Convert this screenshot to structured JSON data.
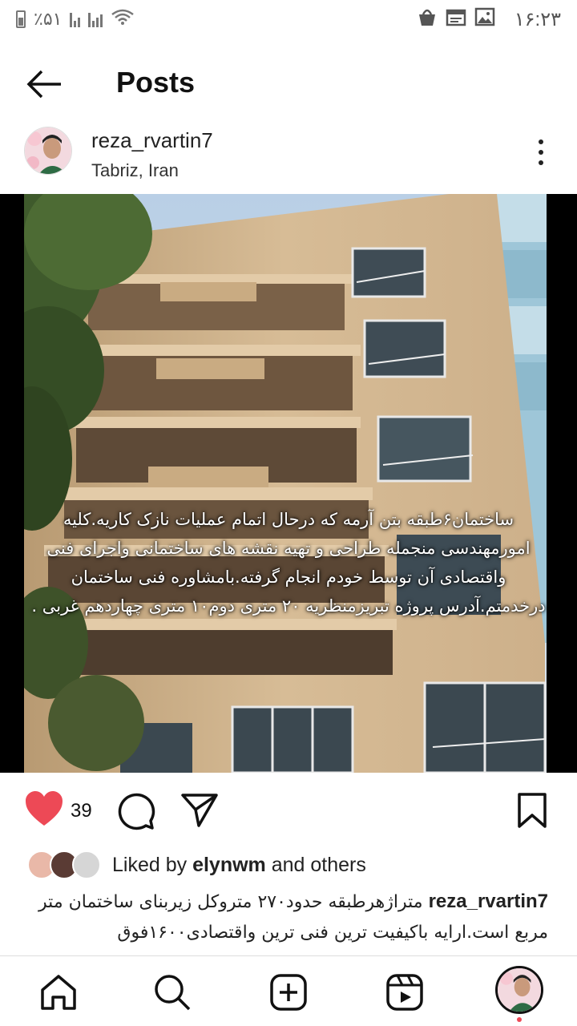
{
  "status_bar": {
    "battery": "٪۵۱",
    "time": "۱۶:۲۳",
    "icons": [
      "battery-icon",
      "signal-icon",
      "signal-icon",
      "wifi-icon",
      "shop-bag-icon",
      "calendar-icon",
      "gallery-icon"
    ]
  },
  "header": {
    "title": "Posts",
    "back_icon": "arrow-left-icon"
  },
  "post": {
    "username": "reza_rvartin7",
    "location": "Tabriz, Iran",
    "more_icon": "more-vertical-icon",
    "image_overlay_lines": [
      "ساختمان۶طبقه بتن آرمه که درحال اتمام عملیات نازک کاریه.کلیه",
      "امورمهندسی منجمله طراحی و تهیه نقشه های ساختمانی واجرای فنی",
      "واقتصادی آن توسط خودم انجام گرفته.بامشاوره فنی ساختمان",
      "درخدمتم.آدرس پروژه تبریزمنظریه ۲۰ متری دوم۱۰ متری چهاردهم غربی ."
    ],
    "like_count": "39",
    "liked_by_prefix": "Liked by",
    "liked_by_user": "elynwm",
    "liked_by_suffix": "and others",
    "caption_user": "reza_rvartin7",
    "caption_text": "متراژهرطبقه حدود۲۷۰ متروکل زیربنای ساختمان متر مربع است.ارایه باکیفیت ترین فنی ترین واقتصادی۱۶۰۰فوق"
  },
  "bottom_nav": [
    "home-icon",
    "search-icon",
    "new-post-icon",
    "reels-icon",
    "profile-avatar"
  ],
  "colors": {
    "like_red": "#ed4956",
    "text": "#111111",
    "muted": "#666666"
  }
}
